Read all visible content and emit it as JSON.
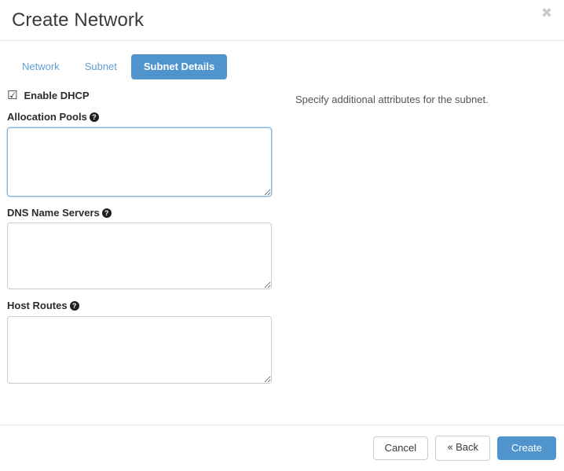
{
  "modal": {
    "title": "Create Network",
    "close_icon": "close-icon",
    "close_glyph": "✖"
  },
  "tabs": [
    {
      "label": "Network",
      "active": false
    },
    {
      "label": "Subnet",
      "active": false
    },
    {
      "label": "Subnet Details",
      "active": true
    }
  ],
  "form": {
    "enable_dhcp": {
      "label": "Enable DHCP",
      "checked": true,
      "glyph": "☑"
    },
    "fields": [
      {
        "label": "Allocation Pools",
        "help_icon": "question-mark-icon",
        "help_glyph": "?",
        "value": "",
        "placeholder": "",
        "focused": true
      },
      {
        "label": "DNS Name Servers",
        "help_icon": "question-mark-icon",
        "help_glyph": "?",
        "value": "",
        "placeholder": "",
        "focused": false
      },
      {
        "label": "Host Routes",
        "help_icon": "question-mark-icon",
        "help_glyph": "?",
        "value": "",
        "placeholder": "",
        "focused": false
      }
    ]
  },
  "side_help": {
    "text": "Specify additional attributes for the subnet."
  },
  "footer": {
    "cancel_label": "Cancel",
    "back_chevron": "«",
    "back_label": "Back",
    "create_label": "Create"
  },
  "colors": {
    "accent": "#4f94cd",
    "tab_link": "#5e9fd4",
    "focus_border": "#83b9e2",
    "border": "#cccccc",
    "divider": "#e7e7e7",
    "text": "#333333",
    "close_icon": "#cccccc"
  }
}
